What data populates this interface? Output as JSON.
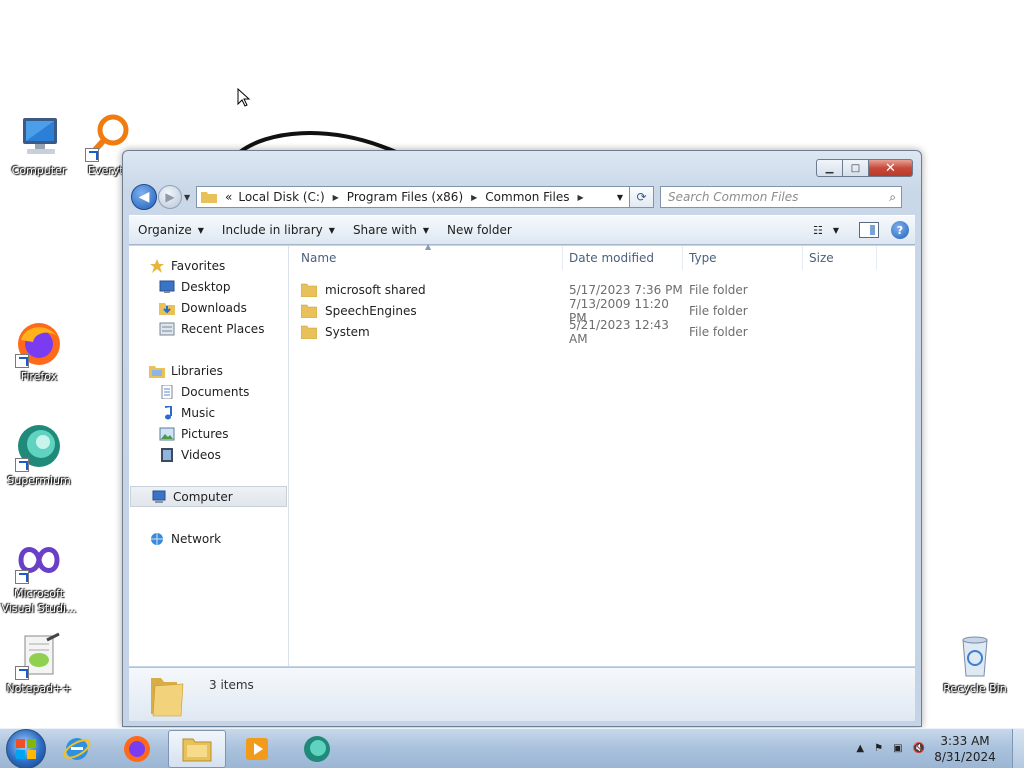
{
  "desktop": {
    "icons": [
      {
        "label": "Computer"
      },
      {
        "label": "Everyt"
      },
      {
        "label": "Firefox"
      },
      {
        "label": "Supermium"
      },
      {
        "label": "Microsoft Visual Studi..."
      },
      {
        "label": "Notepad++"
      },
      {
        "label": "Recycle Bin"
      }
    ]
  },
  "window": {
    "breadcrumb": {
      "overflow": "«",
      "items": [
        "Local Disk (C:)",
        "Program Files (x86)",
        "Common Files"
      ]
    },
    "search_placeholder": "Search Common Files",
    "toolbar": {
      "organize": "Organize",
      "include_in_library": "Include in library",
      "share_with": "Share with",
      "new_folder": "New folder"
    },
    "nav": {
      "favorites": "Favorites",
      "desktop": "Desktop",
      "downloads": "Downloads",
      "recent_places": "Recent Places",
      "libraries": "Libraries",
      "documents": "Documents",
      "music": "Music",
      "pictures": "Pictures",
      "videos": "Videos",
      "computer": "Computer",
      "network": "Network"
    },
    "columns": {
      "name": "Name",
      "date_modified": "Date modified",
      "type": "Type",
      "size": "Size"
    },
    "files": [
      {
        "name": "microsoft shared",
        "date": "5/17/2023 7:36 PM",
        "type": "File folder"
      },
      {
        "name": "SpeechEngines",
        "date": "7/13/2009 11:20 PM",
        "type": "File folder"
      },
      {
        "name": "System",
        "date": "5/21/2023 12:43 AM",
        "type": "File folder"
      }
    ],
    "status": "3 items"
  },
  "taskbar": {
    "apps": [
      "internet-explorer",
      "firefox",
      "windows-explorer",
      "media-player",
      "supermium"
    ],
    "time": "3:33 AM",
    "date": "8/31/2024"
  },
  "colors": {
    "accent": "#2b6cc2",
    "folder": "#e8c15a",
    "close_red": "#c74a3a",
    "taskbar": "#a9c1dc"
  }
}
